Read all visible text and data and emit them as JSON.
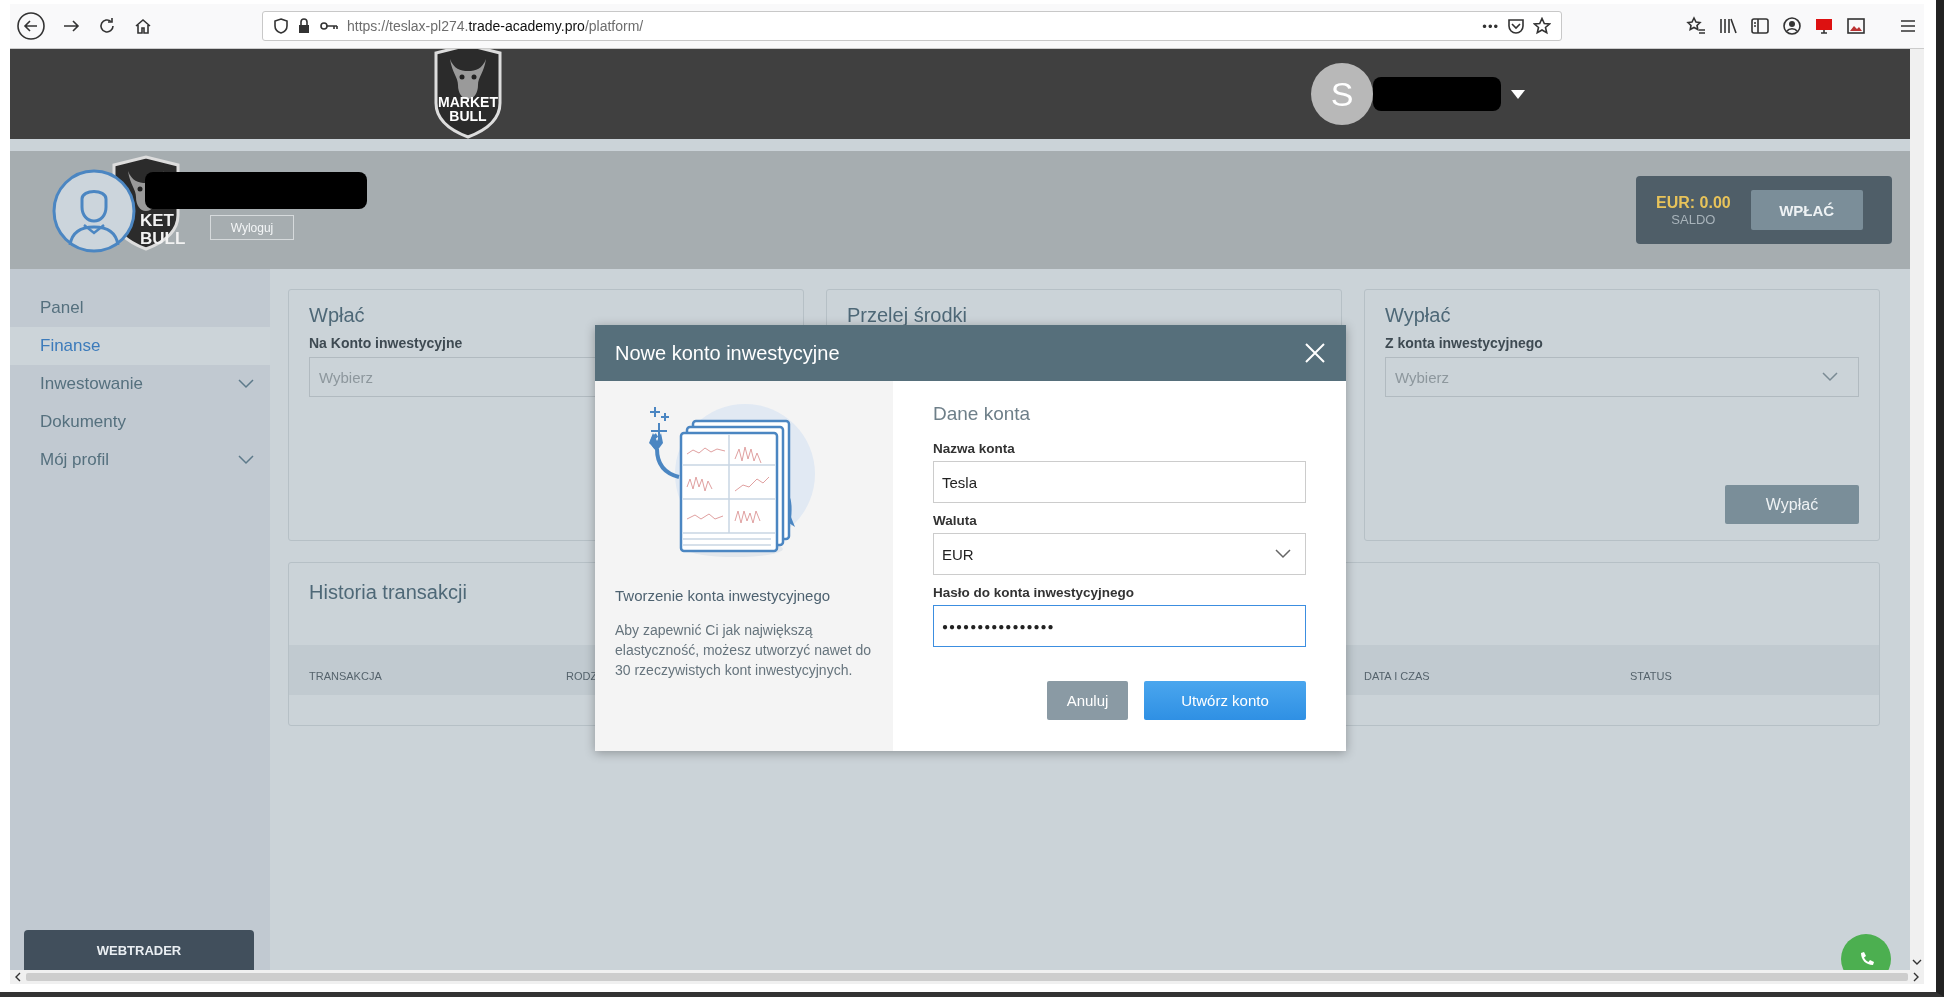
{
  "browser": {
    "url": [
      {
        "text": "https://teslax-pl274.",
        "kind": "muted"
      },
      {
        "text": "trade-academy.pro",
        "kind": "host"
      },
      {
        "text": "/platform/",
        "kind": "muted"
      }
    ],
    "page_actions": "•••"
  },
  "header": {
    "logo": [
      "MARKET",
      "BULL"
    ],
    "user": {
      "initial": "S",
      "name_redacted": true
    }
  },
  "profile": {
    "logo": [
      "KET",
      "BULL"
    ],
    "name_redacted": true,
    "logout": "Wyloguj",
    "balance": "EUR: 0.00",
    "balance_label": "SALDO",
    "deposit_button": "WPŁAĆ"
  },
  "sidebar": {
    "items": [
      {
        "label": "Panel",
        "selected": false,
        "expandable": false
      },
      {
        "label": "Finanse",
        "selected": true,
        "expandable": false
      },
      {
        "label": "Inwestowanie",
        "selected": false,
        "expandable": true
      },
      {
        "label": "Dokumenty",
        "selected": false,
        "expandable": false
      },
      {
        "label": "Mój profil",
        "selected": false,
        "expandable": true
      }
    ],
    "webtrader": "WEBTRADER"
  },
  "cards": [
    {
      "title": "Wpłać",
      "label": "Na Konto inwestycyjne",
      "select": {
        "placeholder": "Wybierz",
        "chevron": false
      }
    },
    {
      "title": "Przelej środki"
    },
    {
      "title": "Wypłać",
      "label": "Z konta inwestycyjnego",
      "select": {
        "placeholder": "Wybierz",
        "chevron": true
      },
      "button": "Wypłać"
    }
  ],
  "history": {
    "title": "Historia transakcji",
    "columns": [
      "TRANSAKCJA",
      "RODZ",
      "DATA I CZAS",
      "STATUS"
    ]
  },
  "modal": {
    "title": "Nowe konto inwestycyjne",
    "intro_title": "Tworzenie konta inwestycyjnego",
    "intro_text": "Aby zapewnić Ci jak największą elastyczność, możesz utworzyć nawet do 30 rzeczywistych kont inwestycyjnych.",
    "form_title": "Dane konta",
    "fields": [
      {
        "kind": "text",
        "label": "Nazwa konta",
        "value": "Tesla",
        "focused": false
      },
      {
        "kind": "select",
        "label": "Waluta",
        "value": "EUR",
        "focused": false
      },
      {
        "kind": "password",
        "label": "Hasło do konta inwestycyjnego",
        "value": "●●●●●●●●●●●●●●●●",
        "focused": true
      }
    ],
    "buttons": [
      {
        "label": "Anuluj",
        "kind": "secondary"
      },
      {
        "label": "Utwórz konto",
        "kind": "primary"
      }
    ]
  }
}
